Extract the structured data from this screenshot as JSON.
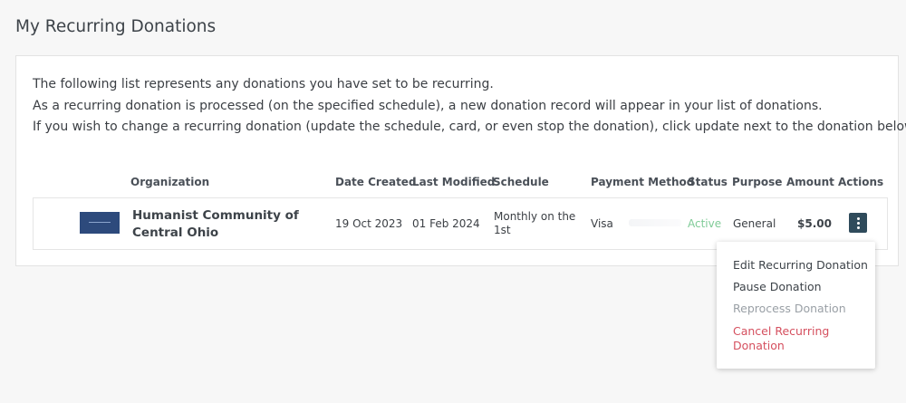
{
  "page": {
    "title": "My Recurring Donations"
  },
  "intro": [
    "The following list represents any donations you have set to be recurring.",
    "As a recurring donation is processed (on the specified schedule), a new donation record will appear in your list of donations.",
    "If you wish to change a recurring donation (update the schedule, card, or even stop the donation), click update next to the donation below."
  ],
  "table": {
    "headers": {
      "organization": "Organization",
      "date_created": "Date Created",
      "last_modified": "Last Modified",
      "schedule": "Schedule",
      "payment_method": "Payment Method",
      "status": "Status",
      "purpose": "Purpose",
      "amount": "Amount",
      "actions": "Actions"
    },
    "rows": [
      {
        "organization": "Humanist Community of Central Ohio",
        "date_created": "19 Oct 2023",
        "last_modified": "01 Feb 2024",
        "schedule": "Monthly on the 1st",
        "payment_method": "Visa",
        "status": "Active",
        "purpose": "General",
        "amount": "$5.00"
      }
    ]
  },
  "actions_menu": {
    "edit": "Edit Recurring Donation",
    "pause": "Pause Donation",
    "reprocess": "Reprocess Donation",
    "cancel": "Cancel Recurring Donation"
  },
  "colors": {
    "status_active": "#7fcb97",
    "danger": "#d5505f",
    "actions_button": "#2f4b5b",
    "logo": "#2d4a7c"
  },
  "icons": {
    "actions_button": "kebab-vertical-icon"
  }
}
